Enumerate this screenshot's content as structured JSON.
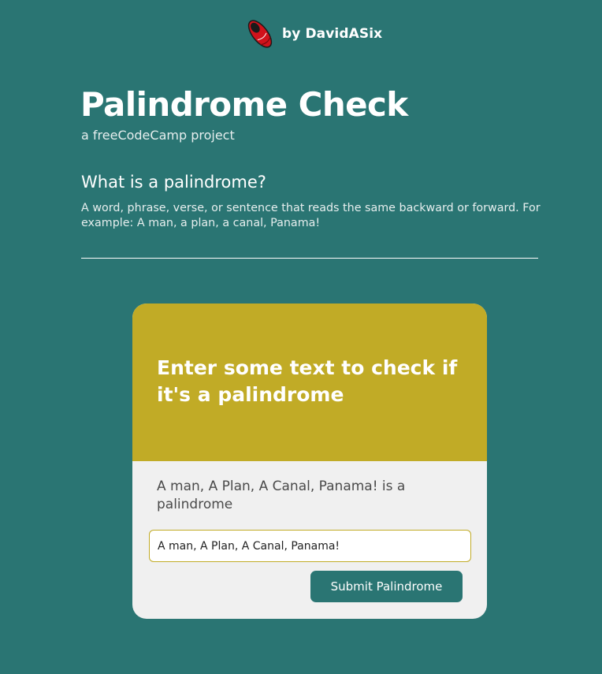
{
  "header": {
    "author_text": "by DavidASix",
    "logo_icon": "red-shoe-logo-icon"
  },
  "intro": {
    "title": "Palindrome Check",
    "subtitle": "a freeCodeCamp project",
    "section_title": "What is a palindrome?",
    "definition": "A word, phrase, verse, or sentence that reads the same backward or forward. For example: A man, a plan, a canal, Panama!"
  },
  "checker": {
    "prompt": "Enter some text to check if it's a palindrome",
    "result": "A man, A Plan, A Canal, Panama! is a palindrome",
    "input_value": "A man, A Plan, A Canal, Panama!",
    "submit_label": "Submit Palindrome"
  },
  "colors": {
    "background": "#2a7573",
    "card_header": "#c1ab26",
    "card_body": "#f0f0f0",
    "button": "#2a7573",
    "logo_red": "#d0121b"
  }
}
